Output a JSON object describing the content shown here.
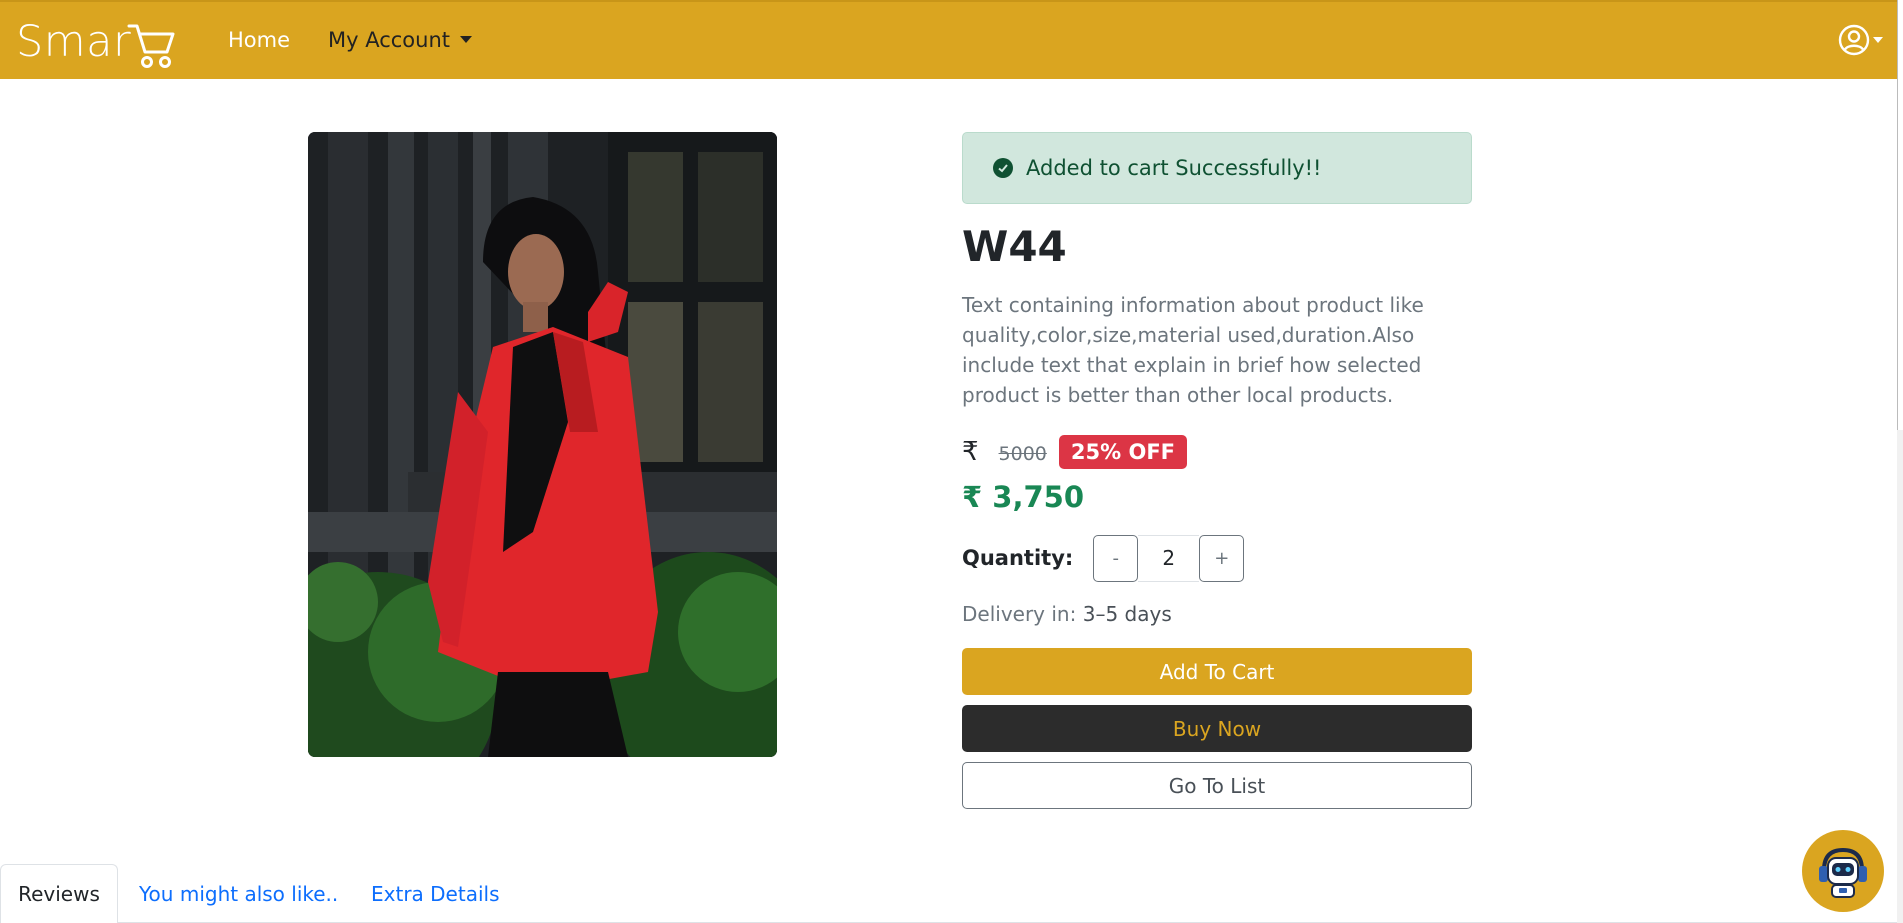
{
  "navbar": {
    "logo_text": "Smar",
    "home_label": "Home",
    "account_label": "My Account",
    "bg_color": "#daa520"
  },
  "alert": {
    "message": "Added to cart Successfully!!"
  },
  "product": {
    "title": "W44",
    "description": "Text containing information about product like quality,color,size,material used,duration.Also include text that explain in brief how selected product is better than other local products.",
    "currency_symbol": "₹",
    "old_price": "5000",
    "discount": "25% OFF",
    "new_price": "₹ 3,750",
    "quantity_label": "Quantity:",
    "quantity": "2",
    "minus_label": "-",
    "plus_label": "+",
    "delivery_label": "Delivery in:",
    "delivery_days": "3–5 days"
  },
  "actions": {
    "add_to_cart": "Add To Cart",
    "buy_now": "Buy Now",
    "go_to_list": "Go To List"
  },
  "tabs": [
    {
      "label": "Reviews",
      "active": true
    },
    {
      "label": "You might also like..",
      "active": false
    },
    {
      "label": "Extra Details",
      "active": false
    }
  ],
  "colors": {
    "accent": "#daa520",
    "success": "#198754",
    "danger": "#dc3545",
    "dark": "#2c2c2c"
  }
}
